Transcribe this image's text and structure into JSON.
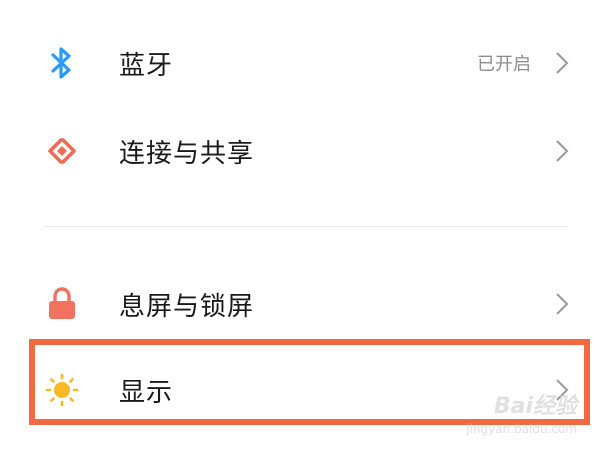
{
  "settings": {
    "items": [
      {
        "label": "蓝牙",
        "value": "已开启",
        "icon": "bluetooth-icon"
      },
      {
        "label": "连接与共享",
        "value": "",
        "icon": "connection-share-icon"
      },
      {
        "label": "息屏与锁屏",
        "value": "",
        "icon": "lock-icon"
      },
      {
        "label": "显示",
        "value": "",
        "icon": "sun-icon"
      }
    ]
  },
  "colors": {
    "highlight": "#ef6a3f",
    "bluetooth": "#2a9af3",
    "connection": "#ec6d56",
    "lock": "#f0735f",
    "sun": "#f7b928"
  },
  "watermark": {
    "brand": "Bai经验",
    "url": "jingyan.baidu.com"
  }
}
